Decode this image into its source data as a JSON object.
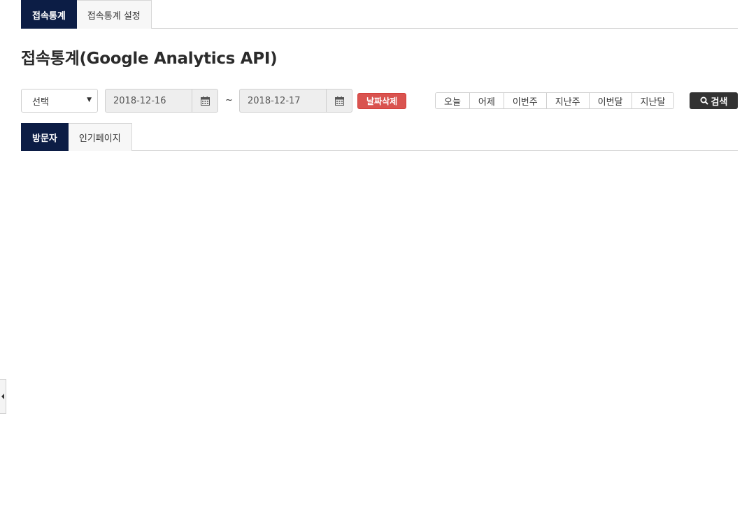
{
  "top_tabs": [
    {
      "label": "접속통계",
      "active": true
    },
    {
      "label": "접속통계 설정",
      "active": false
    }
  ],
  "page_title": "접속통계(Google Analytics API)",
  "filter": {
    "select_value": "선택",
    "date_from": "2018-12-16",
    "date_to": "2018-12-17",
    "range_separator": "~",
    "clear_date_label": "날짜삭제",
    "quick_ranges": [
      "오늘",
      "어제",
      "이번주",
      "지난주",
      "이번달",
      "지난달"
    ],
    "search_label": "검색"
  },
  "sub_tabs": [
    {
      "label": "방문자",
      "active": true
    },
    {
      "label": "인기페이지",
      "active": false
    }
  ],
  "colors": {
    "tab_active_bg": "#0c1d45",
    "clear_button_bg": "#d9534f",
    "search_button_bg": "#333333"
  },
  "icons": {
    "calendar": "calendar-icon",
    "search": "search-icon",
    "dropdown": "caret-down-icon",
    "side_handle": "caret-left-icon"
  }
}
